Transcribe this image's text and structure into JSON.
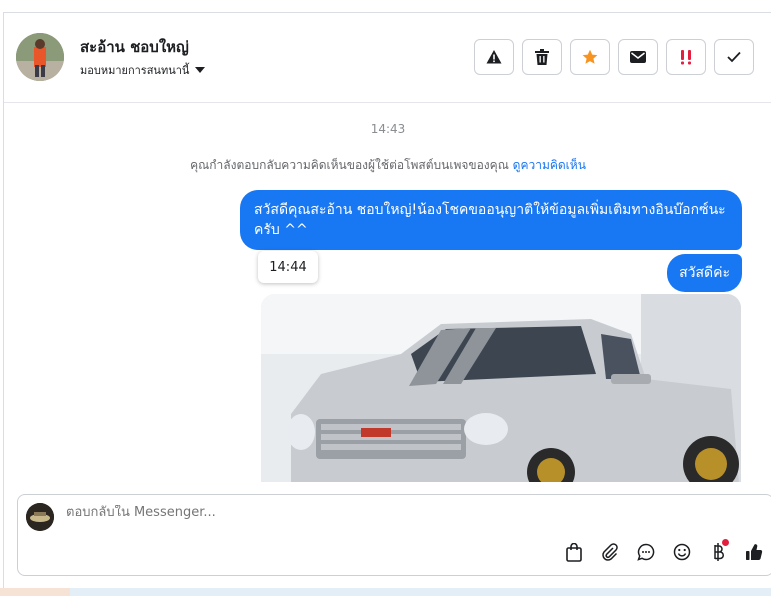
{
  "contact": {
    "name": "สะอ้าน ชอบใหญ่",
    "assign_label": "มอบหมายการสนทนานี้"
  },
  "actions": [
    "warning-icon",
    "trash-icon",
    "star-icon",
    "envelope-icon",
    "double-exclamation-icon",
    "check-icon"
  ],
  "chat": {
    "timestamp": "14:43",
    "notice_text": "คุณกำลังตอบกลับความคิดเห็นของผู้ใช้ต่อโพสต์บนเพจของคุณ",
    "notice_link": "ดูความคิดเห็น",
    "message1": "สวัสดีคุณสะอ้าน ชอบใหญ่!น้องโชคขออนุญาติให้ข้อมูลเพิ่มเติมทางอินบ๊อกซ์นะครับ ^^",
    "tooltip_time": "14:44",
    "message2": "สวัสดีค่ะ"
  },
  "composer": {
    "placeholder": "ตอบกลับใน Messenger...",
    "tools": [
      "shopping-bag-icon",
      "paperclip-icon",
      "chat-bubble-icon",
      "smiley-icon",
      "baht-icon",
      "thumbs-up-icon"
    ]
  },
  "colors": {
    "accent": "#1877f2",
    "star": "#f7931e",
    "alert": "#e41e3f"
  }
}
